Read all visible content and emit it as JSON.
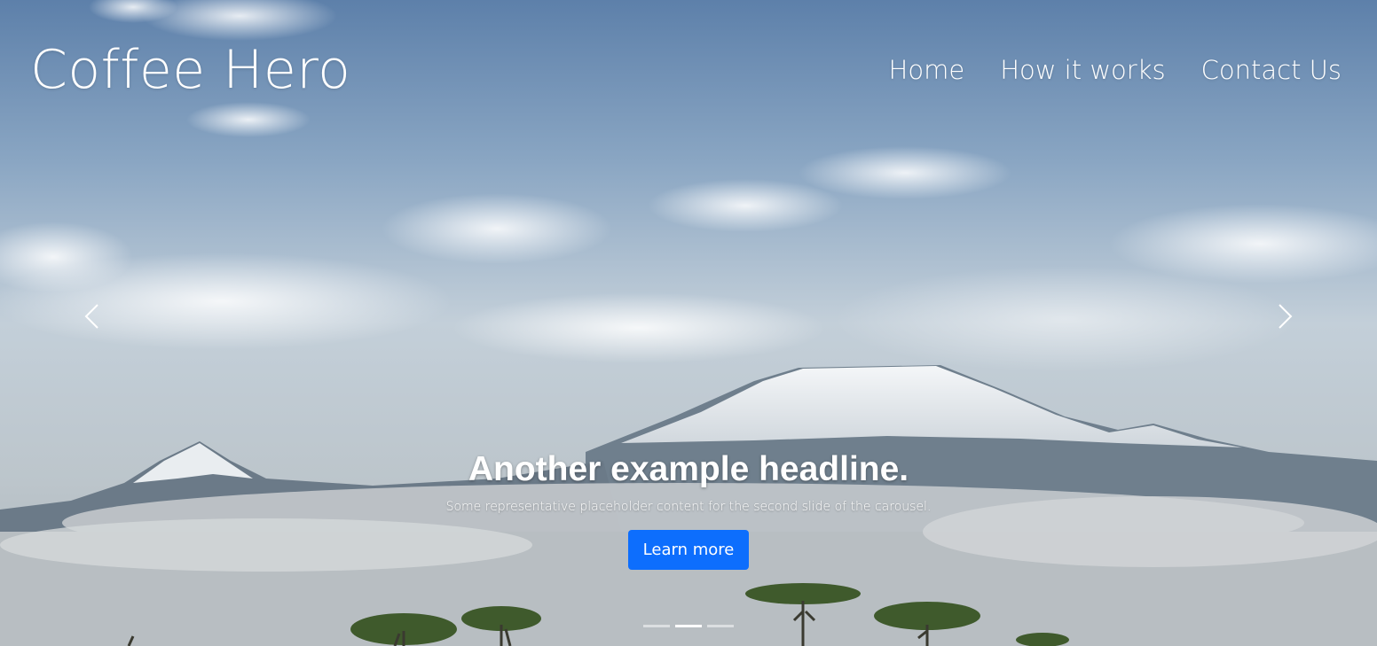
{
  "brand": {
    "title": "Coffee Hero"
  },
  "nav": {
    "items": [
      {
        "label": "Home"
      },
      {
        "label": "How it works"
      },
      {
        "label": "Contact Us"
      }
    ]
  },
  "carousel": {
    "prev_icon": "chevron-left-icon",
    "next_icon": "chevron-right-icon",
    "slide": {
      "headline": "Another example headline.",
      "text": "Some representative placeholder content for the second slide of the carousel.",
      "button_label": "Learn more"
    },
    "indicator_count": 3,
    "active_indicator": 2
  },
  "colors": {
    "button": "#0d6efd",
    "text": "#ffffff"
  }
}
